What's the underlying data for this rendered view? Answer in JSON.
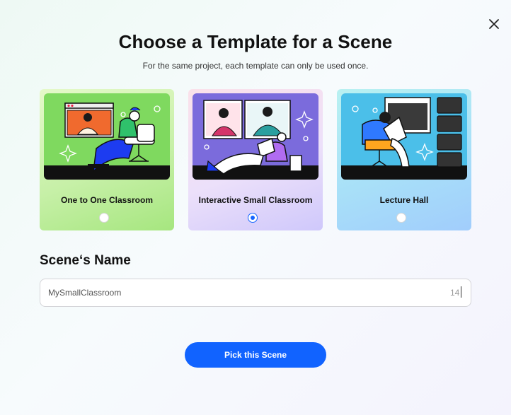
{
  "dialog": {
    "title": "Choose a Template for a Scene",
    "subtitle": "For the same project, each template can only be used once.",
    "close_icon": "close-icon"
  },
  "templates": [
    {
      "label": "One to One Classroom",
      "selected": false,
      "colors": {
        "bg": "#a6e67f",
        "art_bg": "#7fd95f"
      }
    },
    {
      "label": "Interactive Small Classroom",
      "selected": true,
      "colors": {
        "bg": "#cfc8fb",
        "art_bg": "#7b6bdc"
      }
    },
    {
      "label": "Lecture Hall",
      "selected": false,
      "colors": {
        "bg": "#a1cdfc",
        "art_bg": "#4bbfe9"
      }
    }
  ],
  "scene_name": {
    "label": "Scene‘s Name",
    "value": "MySmallClassroom",
    "char_count": "14"
  },
  "actions": {
    "submit_label": "Pick this Scene",
    "accent_color": "#1163ff"
  }
}
